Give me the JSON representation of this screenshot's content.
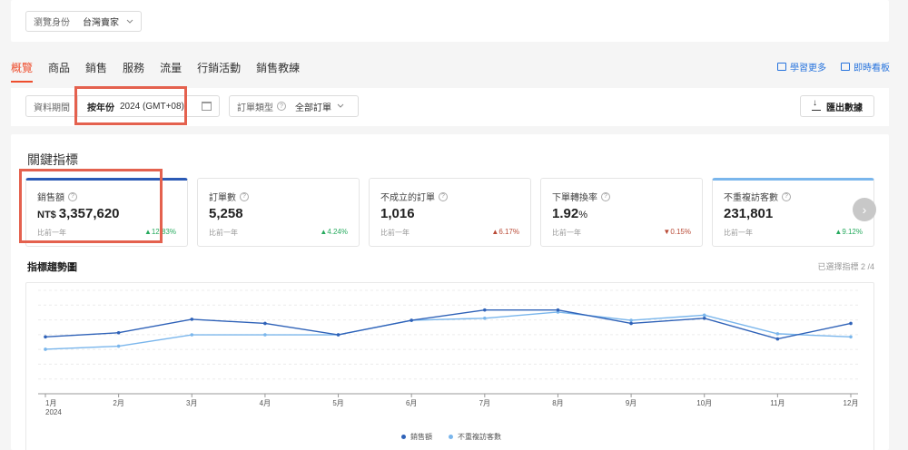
{
  "role": {
    "label": "瀏覽身份",
    "value": "台灣賣家"
  },
  "tabs": [
    {
      "label": "概覽",
      "active": true
    },
    {
      "label": "商品"
    },
    {
      "label": "銷售"
    },
    {
      "label": "服務"
    },
    {
      "label": "流量"
    },
    {
      "label": "行銷活動"
    },
    {
      "label": "銷售教練"
    }
  ],
  "links": {
    "learn_more": "學習更多",
    "live_board": "即時看板"
  },
  "filters": {
    "period_label": "資料期間",
    "period_mode": "按年份",
    "period_value": "2024 (GMT+08)",
    "order_type_label": "訂單類型",
    "order_type_value": "全部訂單",
    "export_label": "匯出數據"
  },
  "key_metrics": {
    "title": "關鍵指標",
    "cards": [
      {
        "title": "銷售額",
        "currency": "NT$",
        "value": "3,357,620",
        "compare": "比前一年",
        "delta": "12.83%",
        "dir": "up"
      },
      {
        "title": "訂單數",
        "value": "5,258",
        "compare": "比前一年",
        "delta": "4.24%",
        "dir": "up"
      },
      {
        "title": "不成立的訂單",
        "value": "1,016",
        "compare": "比前一年",
        "delta": "6.17%",
        "dir": "up"
      },
      {
        "title": "下單轉換率",
        "value": "1.92",
        "unit": "%",
        "compare": "比前一年",
        "delta": "0.15%",
        "dir": "down"
      },
      {
        "title": "不重複訪客數",
        "value": "231,801",
        "compare": "比前一年",
        "delta": "9.12%",
        "dir": "up"
      }
    ]
  },
  "trend": {
    "title": "指標趨勢圖",
    "selected": "已選擇指標 2 /4"
  },
  "chart_data": {
    "type": "line",
    "categories": [
      "1月",
      "2月",
      "3月",
      "4月",
      "5月",
      "6月",
      "7月",
      "8月",
      "9月",
      "10月",
      "11月",
      "12月"
    ],
    "x_sublabel": "2024",
    "series": [
      {
        "name": "銷售額",
        "color": "#2f62b8",
        "values": [
          0.55,
          0.59,
          0.72,
          0.68,
          0.57,
          0.71,
          0.81,
          0.81,
          0.68,
          0.73,
          0.53,
          0.68
        ]
      },
      {
        "name": "不重複訪客數",
        "color": "#7ab6ec",
        "values": [
          0.43,
          0.46,
          0.57,
          0.57,
          0.57,
          0.71,
          0.73,
          0.79,
          0.71,
          0.76,
          0.58,
          0.55
        ]
      }
    ],
    "ylim": [
      0,
      1
    ],
    "grid": true,
    "legend": "bottom-center"
  }
}
